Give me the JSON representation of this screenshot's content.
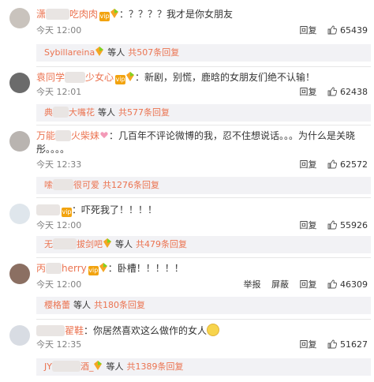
{
  "labels": {
    "reply": "回复",
    "report": "举报",
    "block": "屏蔽",
    "etc": "等人",
    "badge": "vip"
  },
  "comments": [
    {
      "name_head": "潇",
      "name_tail": "吃肉肉",
      "text": "：？？？？我才是你女朋友",
      "time": "今天 12:00",
      "likes": "65439",
      "sub": {
        "name": "Sybillareina",
        "total": "共507条回复"
      }
    },
    {
      "name_head": "袁同学",
      "name_tail": "少女心",
      "text": "：新剧，别慌，鹿晗的女朋友们绝不认输！",
      "time": "今天 12:01",
      "likes": "62438",
      "sub": {
        "name_head": "典",
        "name_tail": "大嘴花",
        "total": "共577条回复"
      }
    },
    {
      "name_head": "万能",
      "name_tail": "火柴妹",
      "text_line1": "：几百年不评论微博的我，忍不住想说话。。。为什么是关晓",
      "text_line2": "彤。。。。",
      "time": "今天 12:33",
      "likes": "62572",
      "sub": {
        "name_head": "嗦",
        "name_tail": "很可爱",
        "total": "共1276条回复"
      }
    },
    {
      "text": "：吓死我了！！！！",
      "time": "今天 12:00",
      "likes": "55926",
      "sub": {
        "name_head": "无",
        "name_tail": "拔剑吧",
        "total": "共479条回复"
      }
    },
    {
      "name_head": "丙",
      "name_tail": "herry",
      "text": "：卧槽！！！！！",
      "time": "今天 12:00",
      "likes": "46309",
      "sub": {
        "name": "樱格蕾",
        "total": "共180条回复"
      }
    },
    {
      "name_tail": "翟鞋",
      "text": "：你居然喜欢这么做作的女人",
      "time": "今天 12:35",
      "likes": "51627",
      "sub": {
        "name_head": "JY",
        "name_tail": "酒_",
        "total": "共1389条回复"
      }
    }
  ],
  "colors": {
    "username": "#eb7350",
    "reply_bar_bg": "#f2f2f5",
    "time": "#808080",
    "badge": "#f2a30f"
  },
  "icons": [
    "thumb-up-icon",
    "vip-badge-icon",
    "rainbow-gem-icon",
    "heart-icon",
    "emoji-icon"
  ]
}
